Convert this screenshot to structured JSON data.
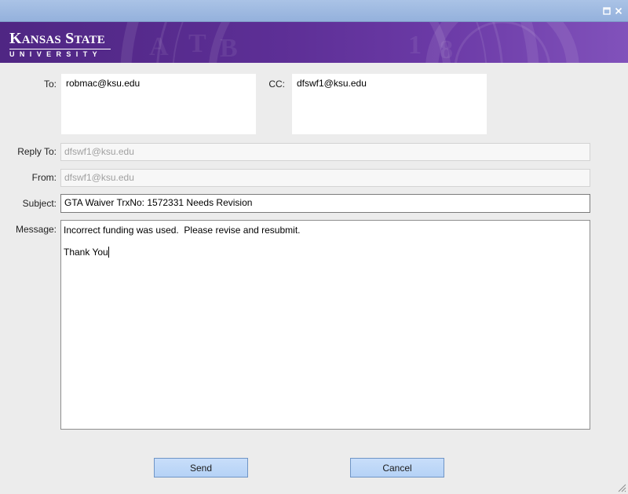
{
  "window": {
    "maximize_icon": "maximize-icon",
    "close_icon": "close-icon",
    "resize_icon": "resize-grip-icon"
  },
  "banner": {
    "name_large_1": "K",
    "name_small_1": "ANSAS",
    "name_large_2": "S",
    "name_small_2": "TATE",
    "subtitle": "UNIVERSITY",
    "background_color": "#512888"
  },
  "form": {
    "to_label": "To:",
    "to_value": "robmac@ksu.edu",
    "cc_label": "CC:",
    "cc_value": "dfswf1@ksu.edu",
    "reply_to_label": "Reply To:",
    "reply_to_value": "dfswf1@ksu.edu",
    "from_label": "From:",
    "from_value": "dfswf1@ksu.edu",
    "subject_label": "Subject:",
    "subject_value": "GTA Waiver TrxNo: 1572331 Needs Revision",
    "message_label": "Message:",
    "message_lines": [
      "Incorrect funding was used.  Please revise and resubmit.",
      "",
      "Thank You"
    ]
  },
  "buttons": {
    "send_label": "Send",
    "cancel_label": "Cancel",
    "button_color": "#c2dbf7"
  }
}
